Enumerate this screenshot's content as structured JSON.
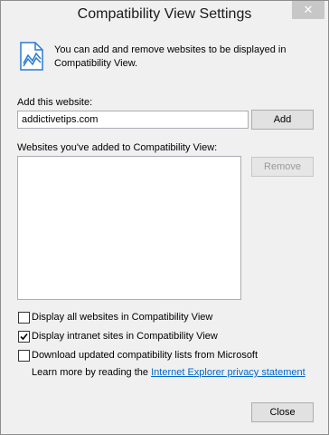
{
  "window": {
    "title": "Compatibility View Settings",
    "close_glyph": "✕"
  },
  "info": {
    "icon": "page-graph-icon",
    "text": "You can add and remove websites to be displayed in Compatibility View."
  },
  "add_site": {
    "label": "Add this website:",
    "value": "addictivetips.com",
    "add_button": "Add"
  },
  "site_list": {
    "label": "Websites you've added to Compatibility View:",
    "items": [],
    "remove_button": "Remove"
  },
  "options": [
    {
      "label": "Display all websites in Compatibility View",
      "checked": false
    },
    {
      "label": "Display intranet sites in Compatibility View",
      "checked": true
    },
    {
      "label": "Download updated compatibility lists from Microsoft",
      "checked": false
    }
  ],
  "learn_more": {
    "prefix": "Learn more by reading the ",
    "link": "Internet Explorer privacy statement"
  },
  "footer": {
    "close_button": "Close"
  },
  "colors": {
    "link": "#0066cc",
    "icon_blue": "#2b7bd0"
  }
}
